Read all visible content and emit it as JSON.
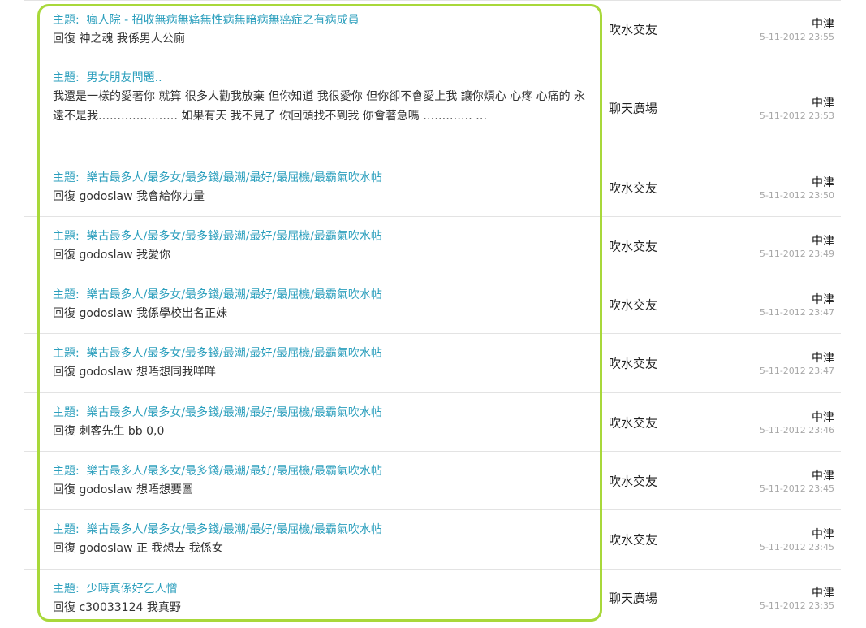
{
  "title_prefix": "主題:",
  "frame_color": "#a8d83a",
  "link_color": "#2c9fbd",
  "posts": [
    {
      "title": "瘋人院 - 招收無病無痛無性病無暗病無癌症之有病成員",
      "reply": "回復 神之魂 我係男人公廁",
      "forum": "吹水交友",
      "location": "中津",
      "time": "5-11-2012 23:55"
    },
    {
      "title": "男女朋友問題..",
      "reply": "我還是一樣的愛著你 就算 很多人勸我放棄 但你知道 我很愛你 但你卻不會愛上我 讓你煩心 心疼 心痛的 永遠不是我………………… 如果有天 我不見了 你回頭找不到我 你會著急嗎 …………. …",
      "forum": "聊天廣場",
      "location": "中津",
      "time": "5-11-2012 23:53"
    },
    {
      "title": "樂古最多人/最多女/最多錢/最潮/最好/最屈機/最霸氣吹水帖",
      "reply": "回復 godoslaw 我會給你力量",
      "forum": "吹水交友",
      "location": "中津",
      "time": "5-11-2012 23:50"
    },
    {
      "title": "樂古最多人/最多女/最多錢/最潮/最好/最屈機/最霸氣吹水帖",
      "reply": "回復 godoslaw 我愛你",
      "forum": "吹水交友",
      "location": "中津",
      "time": "5-11-2012 23:49"
    },
    {
      "title": "樂古最多人/最多女/最多錢/最潮/最好/最屈機/最霸氣吹水帖",
      "reply": "回復 godoslaw 我係學校出名正妹",
      "forum": "吹水交友",
      "location": "中津",
      "time": "5-11-2012 23:47"
    },
    {
      "title": "樂古最多人/最多女/最多錢/最潮/最好/最屈機/最霸氣吹水帖",
      "reply": "回復 godoslaw 想唔想同我咩咩",
      "forum": "吹水交友",
      "location": "中津",
      "time": "5-11-2012 23:47"
    },
    {
      "title": "樂古最多人/最多女/最多錢/最潮/最好/最屈機/最霸氣吹水帖",
      "reply": "回復 刺客先生 bb 0,0",
      "forum": "吹水交友",
      "location": "中津",
      "time": "5-11-2012 23:46"
    },
    {
      "title": "樂古最多人/最多女/最多錢/最潮/最好/最屈機/最霸氣吹水帖",
      "reply": "回復 godoslaw 想唔想要圖",
      "forum": "吹水交友",
      "location": "中津",
      "time": "5-11-2012 23:45"
    },
    {
      "title": "樂古最多人/最多女/最多錢/最潮/最好/最屈機/最霸氣吹水帖",
      "reply": "回復 godoslaw 正 我想去 我係女",
      "forum": "吹水交友",
      "location": "中津",
      "time": "5-11-2012 23:45"
    },
    {
      "title": "少時真係好乞人憎",
      "reply": "回復 c30033124 我真野",
      "forum": "聊天廣場",
      "location": "中津",
      "time": "5-11-2012 23:35"
    }
  ]
}
